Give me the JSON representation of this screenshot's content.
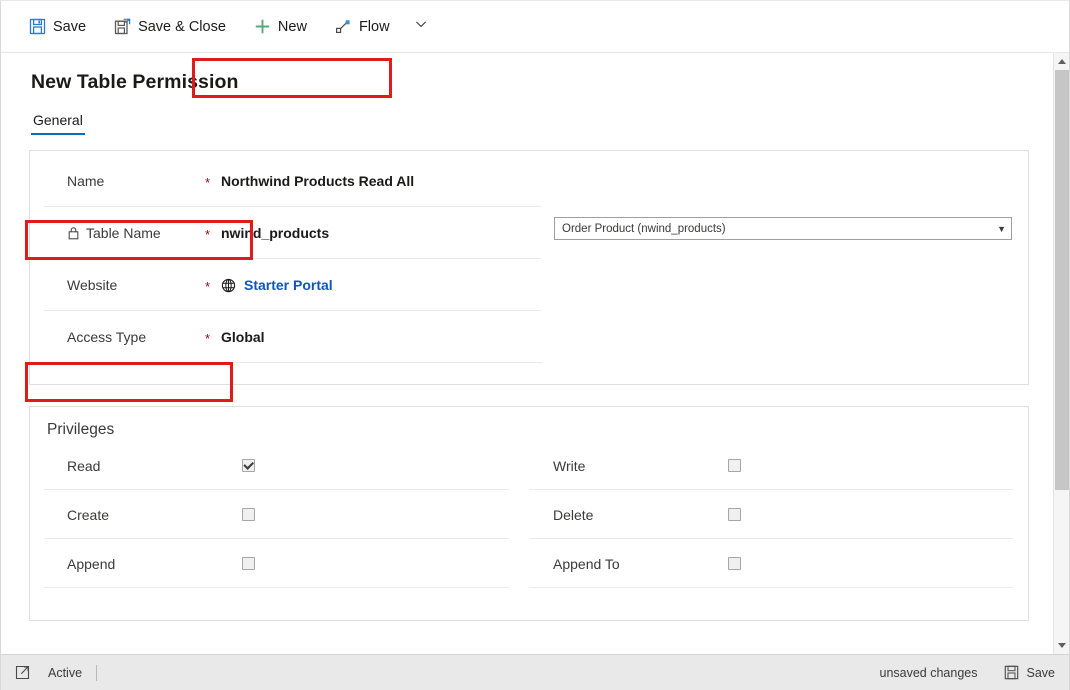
{
  "commandbar": {
    "buttons": [
      {
        "label": "Save",
        "icon": "save-disk-icon"
      },
      {
        "label": "Save & Close",
        "icon": "save-and-close-disk-icon"
      },
      {
        "label": "New",
        "icon": "plus-icon"
      },
      {
        "label": "Flow",
        "icon": "flow-icon"
      }
    ],
    "overflow_icon": "chevron-down-icon"
  },
  "page": {
    "title": "New Table Permission",
    "tabs": [
      {
        "label": "General",
        "active": true
      }
    ]
  },
  "general": {
    "rows": [
      {
        "label": "Name",
        "required": "*",
        "value": "Northwind Products Read All",
        "lock": false,
        "highlighted": true
      },
      {
        "label": "Table Name",
        "required": "*",
        "value": "nwind_products",
        "lock": true,
        "lock_icon": "lock-icon",
        "highlighted": false
      },
      {
        "label": "Website",
        "required": "*",
        "value": "Starter Portal",
        "is_link": true,
        "icon": "globe-icon",
        "highlighted": false
      },
      {
        "label": "Access Type",
        "required": "*",
        "value": "Global",
        "lock": false,
        "highlighted": true
      }
    ],
    "lookup": {
      "value": "Order Product (nwind_products)",
      "caret": "▼"
    }
  },
  "privileges": {
    "heading": "Privileges",
    "left": [
      {
        "label": "Read",
        "checked": true,
        "highlighted": true
      },
      {
        "label": "Create",
        "checked": false,
        "highlighted": false
      },
      {
        "label": "Append",
        "checked": false,
        "highlighted": false
      }
    ],
    "right": [
      {
        "label": "Write",
        "checked": false
      },
      {
        "label": "Delete",
        "checked": false
      },
      {
        "label": "Append To",
        "checked": false
      }
    ]
  },
  "statusbar": {
    "open_icon": "open-record-icon",
    "state": "Active",
    "unsaved": "unsaved changes",
    "save_label": "Save",
    "save_icon": "save-disk-icon"
  },
  "scrollbar": {
    "up": "scroll-up-arrow",
    "down": "scroll-down-arrow"
  },
  "colors": {
    "accent": "#0f6cbd",
    "link": "#0f55c0",
    "required": "#a80000",
    "annotation": "#e01b1b",
    "new_icon": "#5aa97a"
  }
}
